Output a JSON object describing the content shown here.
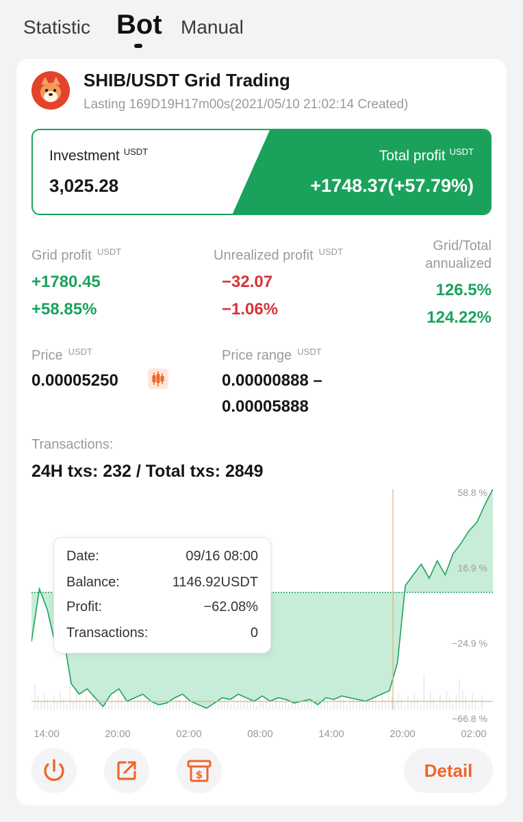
{
  "tabs": [
    {
      "label": "Statistic"
    },
    {
      "label": "Bot"
    },
    {
      "label": "Manual"
    }
  ],
  "bot": {
    "pair_title": "SHIB/USDT Grid Trading",
    "lasting": "Lasting 169D19H17m00s(2021/05/10 21:02:14 Created)",
    "logo_icon": "shiba-inu-logo-icon"
  },
  "investment": {
    "label": "Investment",
    "unit": "USDT",
    "value": "3,025.28"
  },
  "total_profit": {
    "label": "Total profit",
    "unit": "USDT",
    "value": "+1748.37(+57.79%)"
  },
  "grid_profit": {
    "label": "Grid profit",
    "unit": "USDT",
    "value": "+1780.45",
    "percent": "+58.85%"
  },
  "unrealized_profit": {
    "label": "Unrealized profit",
    "unit": "USDT",
    "value": "−32.07",
    "percent": "−1.06%"
  },
  "annualized": {
    "label_line1": "Grid/Total",
    "label_line2": "annualized",
    "grid": "126.5%",
    "total": "124.22%"
  },
  "price": {
    "label": "Price",
    "unit": "USDT",
    "value": "0.00005250",
    "candle_icon": "candlestick-icon"
  },
  "price_range": {
    "label": "Price range",
    "unit": "USDT",
    "line1": "0.00000888 –",
    "line2": "0.00005888"
  },
  "transactions": {
    "label": "Transactions:",
    "summary": "24H txs: 232 / Total txs: 2849"
  },
  "tooltip": {
    "date_label": "Date:",
    "date_value": "09/16 08:00",
    "balance_label": "Balance:",
    "balance_value": "1146.92USDT",
    "profit_label": "Profit:",
    "profit_value": "−62.08%",
    "tx_label": "Transactions:",
    "tx_value": "0"
  },
  "actions": {
    "detail_label": "Detail",
    "icons": [
      "power-icon",
      "share-icon",
      "withdraw-icon"
    ]
  },
  "colors": {
    "profit_green": "#1aa25c",
    "loss_red": "#d6323c",
    "accent_orange": "#f0662a",
    "area_fill": "#c7ecd7"
  },
  "chart_data": {
    "type": "area",
    "y_unit": "%",
    "y_ticks": [
      "58.8 %",
      "16.9 %",
      "−24.9 %",
      "−66.8 %"
    ],
    "ylim": [
      -66.8,
      58.8
    ],
    "x_ticks": [
      "14:00",
      "20:00",
      "02:00",
      "08:00",
      "14:00",
      "20:00",
      "02:00"
    ],
    "zero_baseline": 0,
    "grid": false,
    "series": [
      {
        "values": [
          -28,
          2,
          -10,
          -30,
          -25,
          -52,
          -58,
          -55,
          -60,
          -65,
          -58,
          -55,
          -62,
          -60,
          -58,
          -62,
          -64,
          -63,
          -60,
          -58,
          -62,
          -64,
          -66,
          -63,
          -60,
          -61,
          -58,
          -60,
          -62,
          -59,
          -62,
          -60,
          -61,
          -63,
          -62,
          -61,
          -64,
          -60,
          -61,
          -59,
          -60,
          -61,
          -62,
          -60,
          -58,
          -56,
          -40,
          4,
          10,
          16,
          8,
          18,
          10,
          22,
          28,
          35,
          40,
          50,
          58.8
        ]
      }
    ]
  }
}
